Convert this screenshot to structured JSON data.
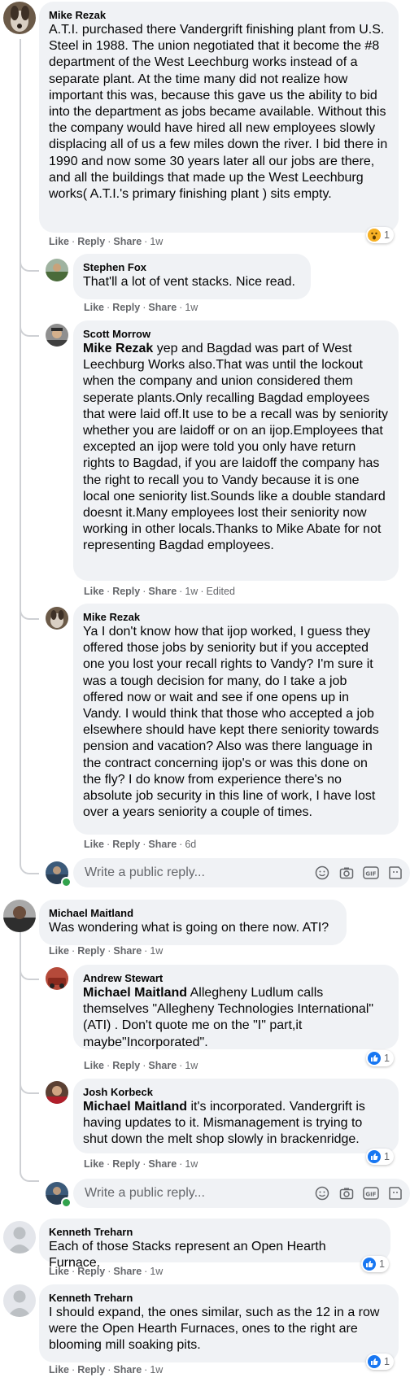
{
  "comments": [
    {
      "author": "Mike Rezak",
      "text": "A.T.I. purchased there Vandergrift finishing plant from U.S. Steel in 1988. The union negotiated that it become the #8 department of the West Leechburg works instead of a separate plant. At the time many did not realize how important this was, because this gave us the ability to bid into the department as jobs became available. Without this the company would have hired all new employees slowly displacing all of us a few miles down the river. I bid there in 1990 and now some 30 years later all our jobs are there, and all the buildings that made up the West Leechburg works( A.T.I.'s primary finishing plant ) sits empty.",
      "like": "Like",
      "reply": "Reply",
      "share": "Share",
      "time": "1w",
      "reaction_count": "1",
      "replies": [
        {
          "author": "Stephen Fox",
          "text": "That'll a lot of vent stacks. Nice read.",
          "like": "Like",
          "reply": "Reply",
          "share": "Share",
          "time": "1w"
        },
        {
          "author": "Scott Morrow",
          "mention": "Mike Rezak",
          "text": " yep and Bagdad was part of West Leechburg Works also.That was until the lockout when the company and union considered them seperate plants.Only recalling Bagdad employees that were laid off.It use to be a recall was by seniority whether you are laidoff or on an ijop.Employees that excepted an ijop were told you only have return rights to Bagdad, if you are laidoff the company has the right to recall you to Vandy because it is one local one seniority list.Sounds like a double standard doesnt it.Many employees lost their seniority now working in other locals.Thanks to Mike Abate for not representing Bagdad employees.",
          "like": "Like",
          "reply": "Reply",
          "share": "Share",
          "time": "1w",
          "edited": "Edited"
        },
        {
          "author": "Mike Rezak",
          "text": "Ya I don't know how that ijop worked, I guess they offered those jobs by seniority but if you accepted one you lost your recall rights to Vandy? I'm sure it was a tough decision for many, do I take a job offered now or wait and see if one opens up in Vandy. I would think that those who accepted a job elsewhere should have kept there seniority towards pension and vacation? Also was there language in the contract concerning ijop's or was this done on the fly? I do know from experience there's no absolute job security in this line of work, I have lost over a years seniority a couple of times.",
          "like": "Like",
          "reply": "Reply",
          "share": "Share",
          "time": "6d"
        }
      ],
      "reply_placeholder": "Write a public reply..."
    },
    {
      "author": "Michael Maitland",
      "text": "Was wondering what is going on there now. ATI?",
      "like": "Like",
      "reply": "Reply",
      "share": "Share",
      "time": "1w",
      "replies": [
        {
          "author": "Andrew Stewart",
          "mention": "Michael Maitland",
          "text": " Allegheny Ludlum calls themselves \"Allegheny Technologies International\" (ATI) . Don't quote me on the \"I\" part,it maybe\"Incorporated\".",
          "like": "Like",
          "reply": "Reply",
          "share": "Share",
          "time": "1w",
          "reaction_count": "1"
        },
        {
          "author": "Josh Korbeck",
          "mention": "Michael Maitland",
          "text": " it's incorporated. Vandergrift is having updates to it. Mismanagement is trying to shut down the melt shop slowly in brackenridge.",
          "like": "Like",
          "reply": "Reply",
          "share": "Share",
          "time": "1w",
          "reaction_count": "1"
        }
      ],
      "reply_placeholder": "Write a public reply..."
    },
    {
      "author": "Kenneth Treharn",
      "text": "Each of those Stacks represent an Open Hearth Furnace.",
      "like": "Like",
      "reply": "Reply",
      "share": "Share",
      "time": "1w",
      "reaction_count": "1"
    },
    {
      "author": "Kenneth Treharn",
      "text": "I should expand, the ones similar, such as the 12 in a row were the Open Hearth Furnaces, ones to the right are blooming mill soaking pits.",
      "like": "Like",
      "reply": "Reply",
      "share": "Share",
      "time": "1w",
      "reaction_count": "1"
    }
  ],
  "colors": {
    "bubble": "#f0f2f5",
    "meta": "#65676b",
    "like_blue": "#1877f2",
    "haha_yellow": "#f7b125",
    "online_green": "#31a24c"
  },
  "icons": [
    "emoji-icon",
    "camera-icon",
    "gif-icon",
    "sticker-icon",
    "like-reaction-icon",
    "wow-reaction-icon"
  ]
}
